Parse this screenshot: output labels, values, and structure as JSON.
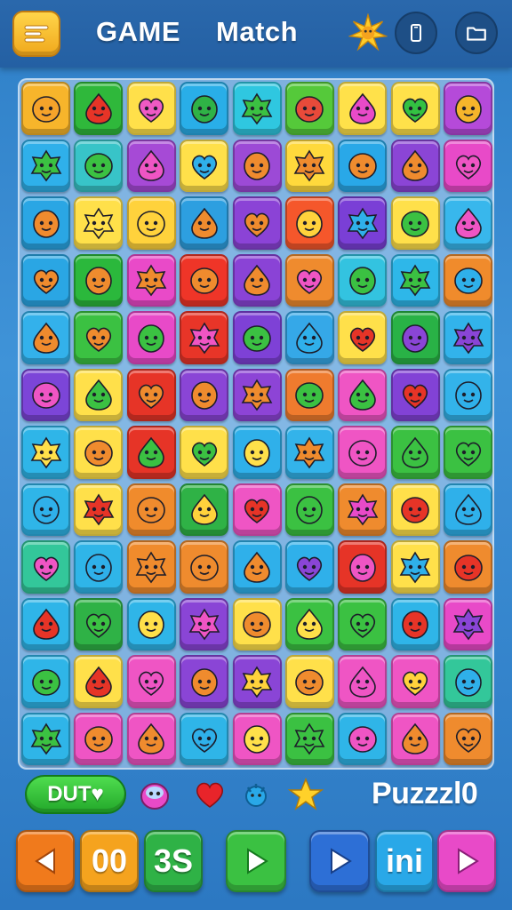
{
  "header": {
    "title_left": "GAME",
    "title_right": "Match",
    "menu_icon": "menu-icon",
    "sun_icon": "sun-icon",
    "phone_icon": "phone-icon",
    "folder_icon": "folder-icon"
  },
  "board": {
    "columns": 9,
    "rows": 12,
    "tiles": [
      [
        "#f7b52b",
        "#2fb83b",
        "#ffe04a",
        "#29aee8",
        "#2fc7e0",
        "#55c93a",
        "#ffe14a",
        "#ffe14a",
        "#b54ad9"
      ],
      [
        "#2fb0ea",
        "#38c4c8",
        "#a64ad6",
        "#ffe04a",
        "#9c4ad6",
        "#ffd93c",
        "#29a8e8",
        "#8b45d6",
        "#e84ac8"
      ],
      [
        "#2aa6e4",
        "#ffe04a",
        "#ffd23c",
        "#2d9fe0",
        "#8b43d6",
        "#f5572b",
        "#7a3fd6",
        "#ffe04a",
        "#38b7ec"
      ],
      [
        "#2aa6e4",
        "#2bb83c",
        "#e94ac8",
        "#ef3528",
        "#8a43d6",
        "#ef8b2e",
        "#33c3e0",
        "#2eb7e9",
        "#f08b2c"
      ],
      [
        "#33b1eb",
        "#3bc142",
        "#e84ac8",
        "#e83528",
        "#7e41d6",
        "#35a8e8",
        "#ffe04a",
        "#29b246",
        "#32b3eb"
      ],
      [
        "#7c45d8",
        "#ffe04a",
        "#e63427",
        "#8a45d6",
        "#8d44d6",
        "#ef7b2e",
        "#ef55c4",
        "#8242d6",
        "#33b3ea"
      ],
      [
        "#2fb5e8",
        "#ffe04a",
        "#e63427",
        "#ffe04a",
        "#2fb0ea",
        "#33b3ea",
        "#ef55c4",
        "#3bc142",
        "#3bc142"
      ],
      [
        "#2fb5e8",
        "#ffe04a",
        "#f08b2c",
        "#2fb246",
        "#ef55c4",
        "#3bc142",
        "#ef8b2e",
        "#ffe04a",
        "#2fb0ea"
      ],
      [
        "#33c79a",
        "#2fb5e8",
        "#f08b2c",
        "#ef8b2e",
        "#2fb0ea",
        "#2fb0ea",
        "#e63427",
        "#ffe04a",
        "#ef8b2e"
      ],
      [
        "#2fb5e8",
        "#2fb246",
        "#2fb5e8",
        "#8a45d6",
        "#ffe04a",
        "#3bc142",
        "#3bc142",
        "#2fb5e8",
        "#e84ac8"
      ],
      [
        "#2fb5e8",
        "#ffe04a",
        "#ef55c4",
        "#8a45d6",
        "#8a45d6",
        "#ffe04a",
        "#ef55c4",
        "#ef55c4",
        "#33c79a"
      ],
      [
        "#2fb5e8",
        "#ef55c4",
        "#ef55c4",
        "#2fb5e8",
        "#ef55c4",
        "#3bc142",
        "#2fb5e8",
        "#ef55c4",
        "#ef8b2e"
      ]
    ],
    "face_colors": [
      [
        "#f5a32a",
        "#e63427",
        "#ef5ac4",
        "#2fb246",
        "#3bc142",
        "#e84a3a",
        "#e84ac8",
        "#33c142",
        "#f5b52b"
      ],
      [
        "#3bc142",
        "#3bc142",
        "#ef55c4",
        "#2fb0ea",
        "#ef8b2e",
        "#ef8b2e",
        "#ef8b2e",
        "#ef8b2e",
        "#ef55c4"
      ],
      [
        "#ef8b2e",
        "#ffe04a",
        "#ffd23c",
        "#ef8b2e",
        "#ef8b2e",
        "#ffd23c",
        "#2fb0ea",
        "#3bc142",
        "#ef55c4"
      ],
      [
        "#ef8b2e",
        "#ef8b2e",
        "#ef8b2e",
        "#ef8b2e",
        "#ef8b2e",
        "#ef55c4",
        "#3bc142",
        "#3bc142",
        "#2fb0ea"
      ],
      [
        "#ef8b2e",
        "#ef8b2e",
        "#3bc142",
        "#ef55c4",
        "#3bc142",
        "#2fb0ea",
        "#e63427",
        "#8a45d6",
        "#8a45d6"
      ],
      [
        "#ef55c4",
        "#3bc142",
        "#ef8b2e",
        "#ef8b2e",
        "#ef8b2e",
        "#3bc142",
        "#3bc142",
        "#e63427",
        "#2fb0ea"
      ],
      [
        "#ffe04a",
        "#ef8b2e",
        "#3bc142",
        "#3bc142",
        "#ffe04a",
        "#ef8b2e",
        "#ef55c4",
        "#3bc142",
        "#3bc142"
      ],
      [
        "#2fb0ea",
        "#e63427",
        "#ef8b2e",
        "#ffd23c",
        "#e63427",
        "#3bc142",
        "#e84ac8",
        "#e63427",
        "#2fb0ea"
      ],
      [
        "#ef55c4",
        "#2fb0ea",
        "#ef8b2e",
        "#ef8b2e",
        "#ef8b2e",
        "#8a45d6",
        "#ef55c4",
        "#2fb0ea",
        "#e63427"
      ],
      [
        "#e63427",
        "#3bc142",
        "#ffe04a",
        "#ef55c4",
        "#ef8b2e",
        "#ffe04a",
        "#3bc142",
        "#e63427",
        "#8a45d6"
      ],
      [
        "#3bc142",
        "#e63427",
        "#ef55c4",
        "#ef8b2e",
        "#ffd23c",
        "#ef8b2e",
        "#ef55c4",
        "#ffd23c",
        "#2fb0ea"
      ],
      [
        "#3bc142",
        "#ef8b2e",
        "#ef8b2e",
        "#2fb0ea",
        "#ffe04a",
        "#3bc142",
        "#ef55c4",
        "#ef8b2e",
        "#ef8b2e"
      ]
    ]
  },
  "status": {
    "duty_label": "DUT♥",
    "logo_text": "Puzzzl0",
    "icons": [
      "monster-icon",
      "heart-icon",
      "blue-creature-icon",
      "star-icon"
    ]
  },
  "controls": [
    {
      "name": "prev-button",
      "icon": "left-arrow-icon",
      "label": "",
      "color": "#f07a1c"
    },
    {
      "name": "score-a-button",
      "icon": "",
      "label": "00",
      "color": "#f5a31e"
    },
    {
      "name": "score-b-button",
      "icon": "",
      "label": "3S",
      "color": "#2fb246"
    },
    {
      "name": "play-button",
      "icon": "play-icon",
      "label": "",
      "color": "#3bc142"
    },
    {
      "name": "forward-button",
      "icon": "play-icon",
      "label": "",
      "color": "#2d6fd6"
    },
    {
      "name": "pause-button",
      "icon": "",
      "label": "ini",
      "color": "#29a8e8"
    },
    {
      "name": "next-button",
      "icon": "play-icon",
      "label": "",
      "color": "#e84ac8"
    }
  ]
}
